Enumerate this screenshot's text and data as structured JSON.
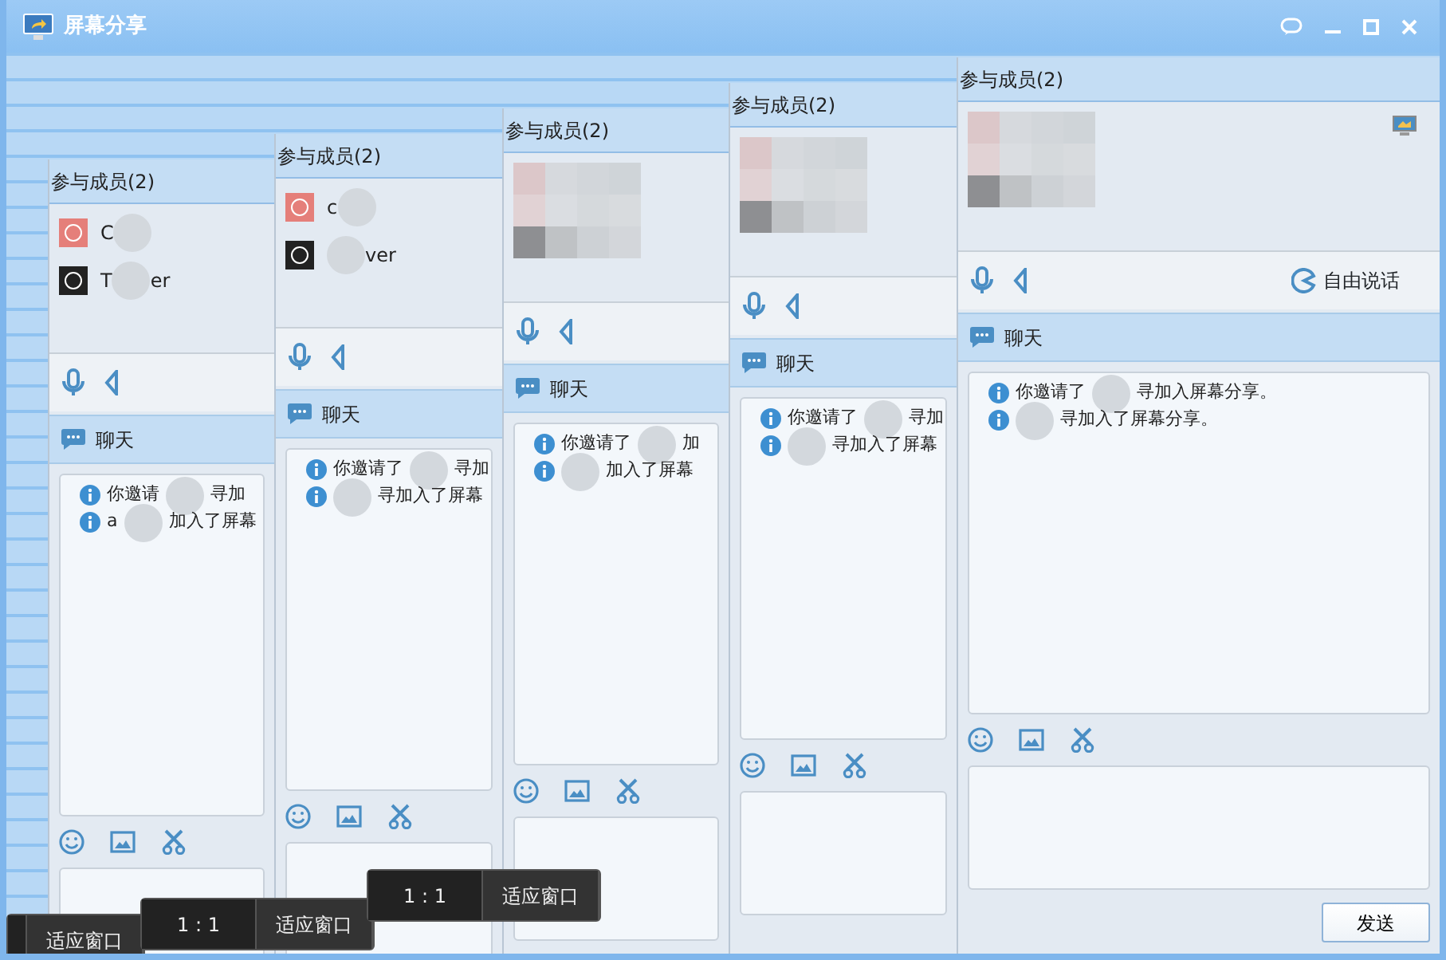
{
  "window": {
    "title": "屏幕分享"
  },
  "panels": [
    {
      "header": "参与成员(2)",
      "kind": "list",
      "members": [
        {
          "color": "#e57f7a",
          "parts": [
            {
              "kind": "text",
              "text": "C"
            },
            {
              "kind": "blur"
            }
          ]
        },
        {
          "color": "#222222",
          "parts": [
            {
              "kind": "text",
              "text": "T"
            },
            {
              "kind": "blur"
            },
            {
              "kind": "text",
              "text": "er"
            }
          ]
        }
      ],
      "chat_label": "聊天",
      "messages": [
        [
          {
            "kind": "text",
            "text": "你邀请"
          },
          {
            "kind": "blur"
          },
          {
            "kind": "text",
            "text": "寻加"
          }
        ],
        [
          {
            "kind": "text",
            "text": "a"
          },
          {
            "kind": "blur"
          },
          {
            "kind": "text",
            "text": "加入了屏幕"
          }
        ]
      ]
    },
    {
      "header": "参与成员(2)",
      "kind": "list",
      "members": [
        {
          "color": "#e57f7a",
          "parts": [
            {
              "kind": "text",
              "text": "c"
            },
            {
              "kind": "blur"
            }
          ]
        },
        {
          "color": "#222222",
          "parts": [
            {
              "kind": "blur"
            },
            {
              "kind": "text",
              "text": "ver"
            }
          ]
        }
      ],
      "chat_label": "聊天",
      "messages": [
        [
          {
            "kind": "text",
            "text": "你邀请了"
          },
          {
            "kind": "blur"
          },
          {
            "kind": "text",
            "text": "寻加"
          }
        ],
        [
          {
            "kind": "blur"
          },
          {
            "kind": "text",
            "text": "寻加入了屏幕"
          }
        ]
      ]
    },
    {
      "header": "参与成员(2)",
      "kind": "mosaic",
      "chat_label": "聊天",
      "messages": [
        [
          {
            "kind": "text",
            "text": "你邀请了"
          },
          {
            "kind": "blur"
          },
          {
            "kind": "text",
            "text": "加"
          }
        ],
        [
          {
            "kind": "blur"
          },
          {
            "kind": "text",
            "text": "加入了屏幕"
          }
        ]
      ]
    },
    {
      "header": "参与成员(2)",
      "kind": "mosaic",
      "chat_label": "聊天",
      "messages": [
        [
          {
            "kind": "text",
            "text": "你邀请了"
          },
          {
            "kind": "blur"
          },
          {
            "kind": "text",
            "text": "寻加"
          }
        ],
        [
          {
            "kind": "blur"
          },
          {
            "kind": "text",
            "text": "寻加入了屏幕"
          }
        ]
      ]
    },
    {
      "header": "参与成员(2)",
      "kind": "mosaic",
      "free_talk": "自由说话",
      "chat_label": "聊天",
      "messages": [
        [
          {
            "kind": "text",
            "text": "你邀请了"
          },
          {
            "kind": "blur"
          },
          {
            "kind": "text",
            "text": "寻加入屏幕分享。"
          }
        ],
        [
          {
            "kind": "blur"
          },
          {
            "kind": "text",
            "text": "寻加入了屏幕分享。"
          }
        ]
      ],
      "send": "发送"
    }
  ],
  "zoom_bars": [
    {
      "buttons": [
        "适应窗口"
      ]
    },
    {
      "buttons": [
        "1 : 1",
        "适应窗口"
      ]
    },
    {
      "buttons": [
        "1 : 1",
        "适应窗口"
      ]
    }
  ]
}
